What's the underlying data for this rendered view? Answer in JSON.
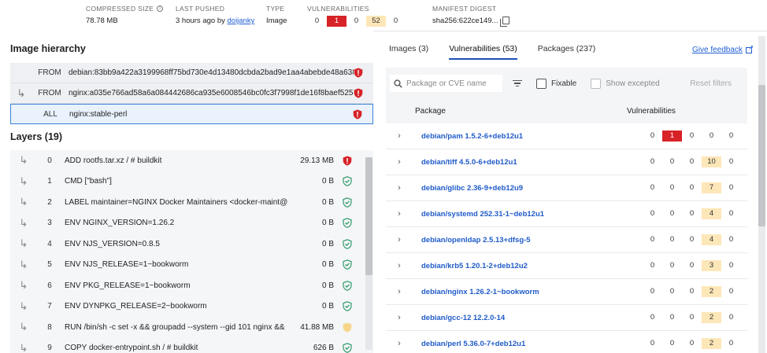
{
  "meta": {
    "compressed_size_label": "COMPRESSED SIZE",
    "compressed_size_value": "78.78 MB",
    "last_pushed_label": "LAST PUSHED",
    "last_pushed_prefix": "3 hours ago by",
    "last_pushed_user": "doijanky",
    "type_label": "TYPE",
    "type_value": "Image",
    "vulns_label": "VULNERABILITIES",
    "vulns": [
      "0",
      "1",
      "0",
      "52",
      "0"
    ],
    "digest_label": "MANIFEST DIGEST",
    "digest_value": "sha256:622ce149..."
  },
  "hierarchy": {
    "title": "Image hierarchy",
    "rows": [
      {
        "keyword": "FROM",
        "image": "debian:83bb9a422a3199968ff75bd730e4d13480dcbda2bad9e1aa4abebde48a638..."
      },
      {
        "keyword": "FROM",
        "image": "nginx:a035e766ad58a6a084442686ca935e6008546bc0fc3f7998f1de16f8baef525c"
      },
      {
        "keyword": "ALL",
        "image": "nginx:stable-perl"
      }
    ]
  },
  "layers": {
    "title": "Layers (19)",
    "rows": [
      {
        "num": "0",
        "cmd": "ADD rootfs.tar.xz / # buildkit",
        "size": "29.13 MB",
        "status": "critical"
      },
      {
        "num": "1",
        "cmd": "CMD [\"bash\"]",
        "size": "0 B",
        "status": "ok"
      },
      {
        "num": "2",
        "cmd": "LABEL maintainer=NGINX Docker Maintainers <docker-maint@ngi...",
        "size": "0 B",
        "status": "ok"
      },
      {
        "num": "3",
        "cmd": "ENV NGINX_VERSION=1.26.2",
        "size": "0 B",
        "status": "ok"
      },
      {
        "num": "4",
        "cmd": "ENV NJS_VERSION=0.8.5",
        "size": "0 B",
        "status": "ok"
      },
      {
        "num": "5",
        "cmd": "ENV NJS_RELEASE=1~bookworm",
        "size": "0 B",
        "status": "ok"
      },
      {
        "num": "6",
        "cmd": "ENV PKG_RELEASE=1~bookworm",
        "size": "0 B",
        "status": "ok"
      },
      {
        "num": "7",
        "cmd": "ENV DYNPKG_RELEASE=2~bookworm",
        "size": "0 B",
        "status": "ok"
      },
      {
        "num": "8",
        "cmd": "RUN /bin/sh -c set -x && groupadd --system --gid 101 nginx && use...",
        "size": "41.88 MB",
        "status": "medium"
      },
      {
        "num": "9",
        "cmd": "COPY docker-entrypoint.sh / # buildkit",
        "size": "626 B",
        "status": "ok"
      }
    ]
  },
  "tabs": [
    {
      "label": "Images (3)",
      "active": false
    },
    {
      "label": "Vulnerabilities (53)",
      "active": true
    },
    {
      "label": "Packages (237)",
      "active": false
    }
  ],
  "feedback_label": "Give feedback",
  "filters": {
    "search_placeholder": "Package or CVE name",
    "fixable_label": "Fixable",
    "show_excepted_label": "Show excepted",
    "reset_label": "Reset filters"
  },
  "table": {
    "col_package": "Package",
    "col_vulns": "Vulnerabilities",
    "rows": [
      {
        "name": "debian/pam 1.5.2-6+deb12u1",
        "counts": [
          "0",
          "1",
          "0",
          "0",
          "0"
        ],
        "highlight": 1,
        "hl_type": "c"
      },
      {
        "name": "debian/tiff 4.5.0-6+deb12u1",
        "counts": [
          "0",
          "0",
          "0",
          "10",
          "0"
        ],
        "highlight": 3,
        "hl_type": "m"
      },
      {
        "name": "debian/glibc 2.36-9+deb12u9",
        "counts": [
          "0",
          "0",
          "0",
          "7",
          "0"
        ],
        "highlight": 3,
        "hl_type": "m"
      },
      {
        "name": "debian/systemd 252.31-1~deb12u1",
        "counts": [
          "0",
          "0",
          "0",
          "4",
          "0"
        ],
        "highlight": 3,
        "hl_type": "m"
      },
      {
        "name": "debian/openldap 2.5.13+dfsg-5",
        "counts": [
          "0",
          "0",
          "0",
          "4",
          "0"
        ],
        "highlight": 3,
        "hl_type": "m"
      },
      {
        "name": "debian/krb5 1.20.1-2+deb12u2",
        "counts": [
          "0",
          "0",
          "0",
          "3",
          "0"
        ],
        "highlight": 3,
        "hl_type": "m"
      },
      {
        "name": "debian/nginx 1.26.2-1~bookworm",
        "counts": [
          "0",
          "0",
          "0",
          "2",
          "0"
        ],
        "highlight": 3,
        "hl_type": "m"
      },
      {
        "name": "debian/gcc-12 12.2.0-14",
        "counts": [
          "0",
          "0",
          "0",
          "2",
          "0"
        ],
        "highlight": 3,
        "hl_type": "m"
      },
      {
        "name": "debian/perl 5.36.0-7+deb12u1",
        "counts": [
          "0",
          "0",
          "0",
          "2",
          "0"
        ],
        "highlight": 3,
        "hl_type": "m"
      }
    ]
  },
  "colors": {
    "critical": "#d72228",
    "medium": "#fde7b8",
    "ok": "#2e9a6a",
    "link": "#2160d4"
  }
}
